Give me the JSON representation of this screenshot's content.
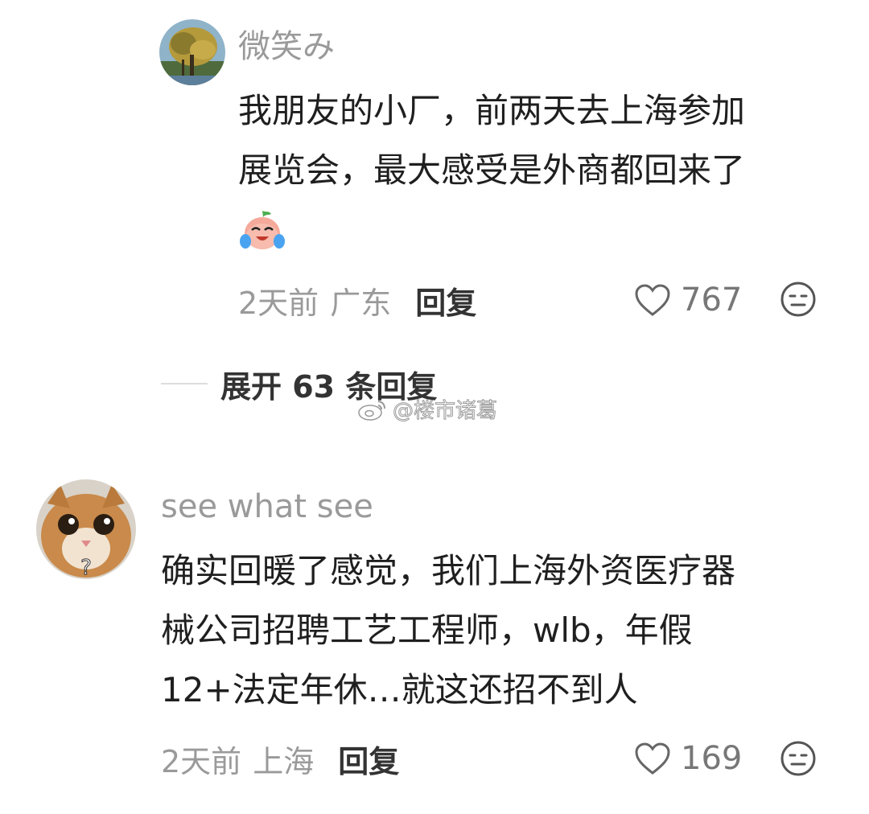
{
  "comments": [
    {
      "username": "微笑み",
      "text_lines": [
        "我朋友的小厂，前两天去上海参加",
        "展览会，最大感受是外商都回来了"
      ],
      "emoji": "crying-laughing-emoji",
      "time": "2天前",
      "location": "广东",
      "reply_label": "回复",
      "likes": "767",
      "replies_label": "展开 63 条回复",
      "avatar": "tree-photo"
    },
    {
      "username": "see what see",
      "text_lines": [
        "确实回暖了感觉，我们上海外资医疗器",
        "械公司招聘工艺工程师，wlb，年假",
        "12+法定年休…就这还招不到人"
      ],
      "time": "2天前",
      "location": "上海",
      "reply_label": "回复",
      "likes": "169",
      "avatar": "cat-photo"
    }
  ],
  "watermark": "@楼市诸葛",
  "icons": {
    "like": "heart-outline-icon",
    "react": "neutral-face-icon",
    "watermark": "weibo-logo-icon"
  },
  "colors": {
    "meta_gray": "#9a9a9a",
    "text": "#1f1f1f",
    "bold_action": "#333333"
  }
}
